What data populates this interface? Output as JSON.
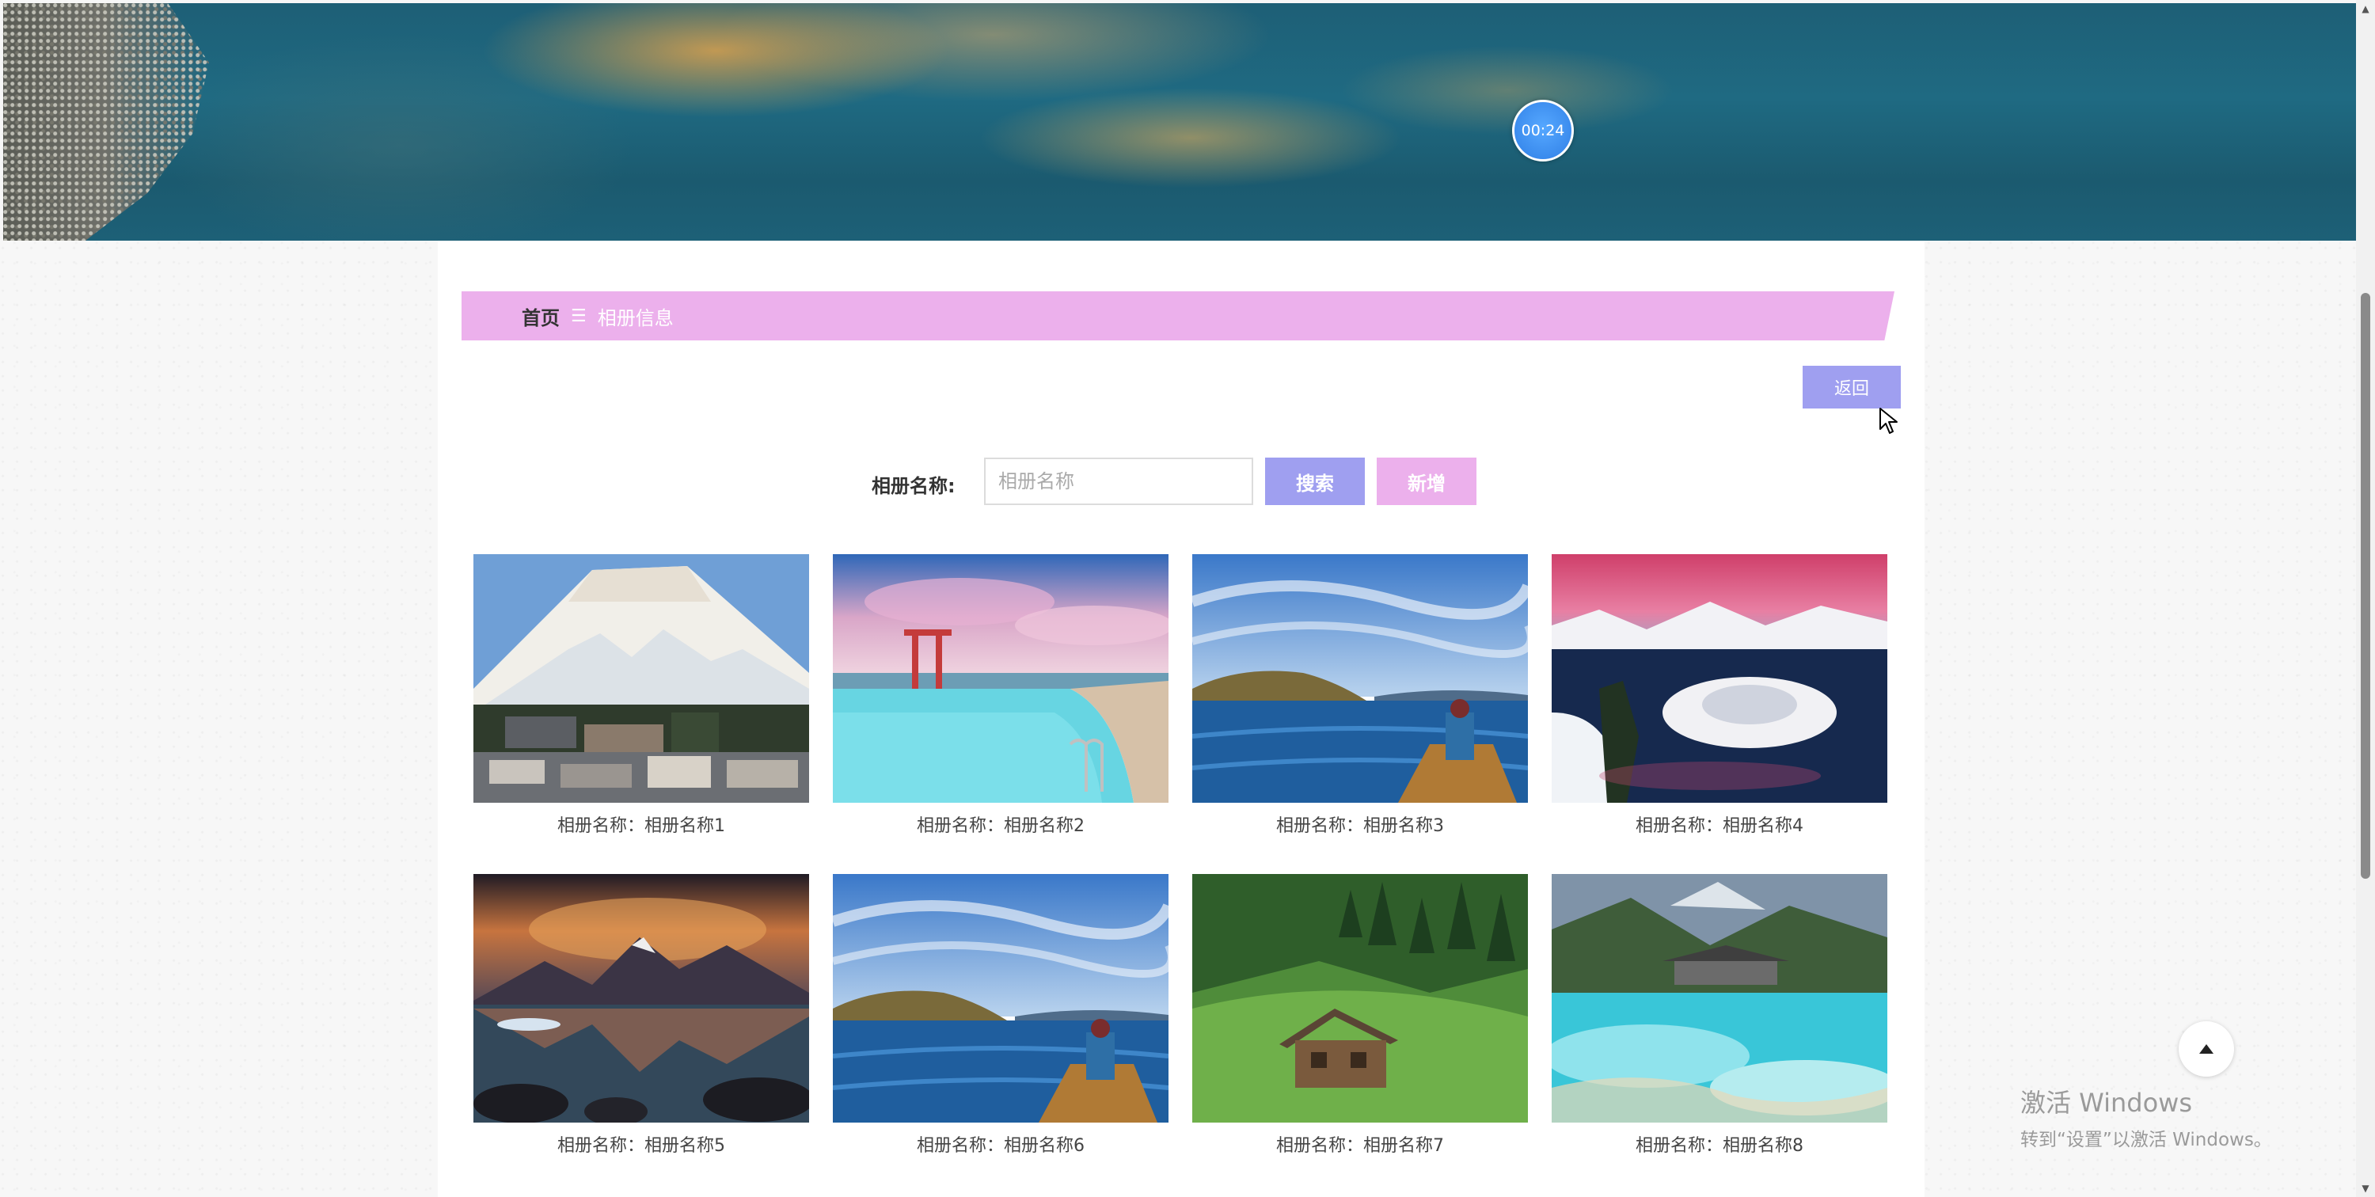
{
  "banner": {
    "timer": "00:24"
  },
  "breadcrumb": {
    "home": "首页",
    "separator": "☰",
    "current": "相册信息"
  },
  "actions": {
    "back_label": "返回"
  },
  "search": {
    "label": "相册名称:",
    "placeholder": "相册名称",
    "value": "",
    "search_label": "搜索",
    "add_label": "新增"
  },
  "albums": [
    {
      "caption": "相册名称：相册名称1"
    },
    {
      "caption": "相册名称：相册名称2"
    },
    {
      "caption": "相册名称：相册名称3"
    },
    {
      "caption": "相册名称：相册名称4"
    },
    {
      "caption": "相册名称：相册名称5"
    },
    {
      "caption": "相册名称：相册名称6"
    },
    {
      "caption": "相册名称：相册名称7"
    },
    {
      "caption": "相册名称：相册名称8"
    }
  ],
  "watermark": {
    "title": "激活 Windows",
    "subtitle": "转到“设置”以激活 Windows。"
  },
  "colors": {
    "primary_button": "#9f9ff0",
    "accent_pink": "#ecb0ec",
    "timer_blue": "#2f7fe6"
  }
}
